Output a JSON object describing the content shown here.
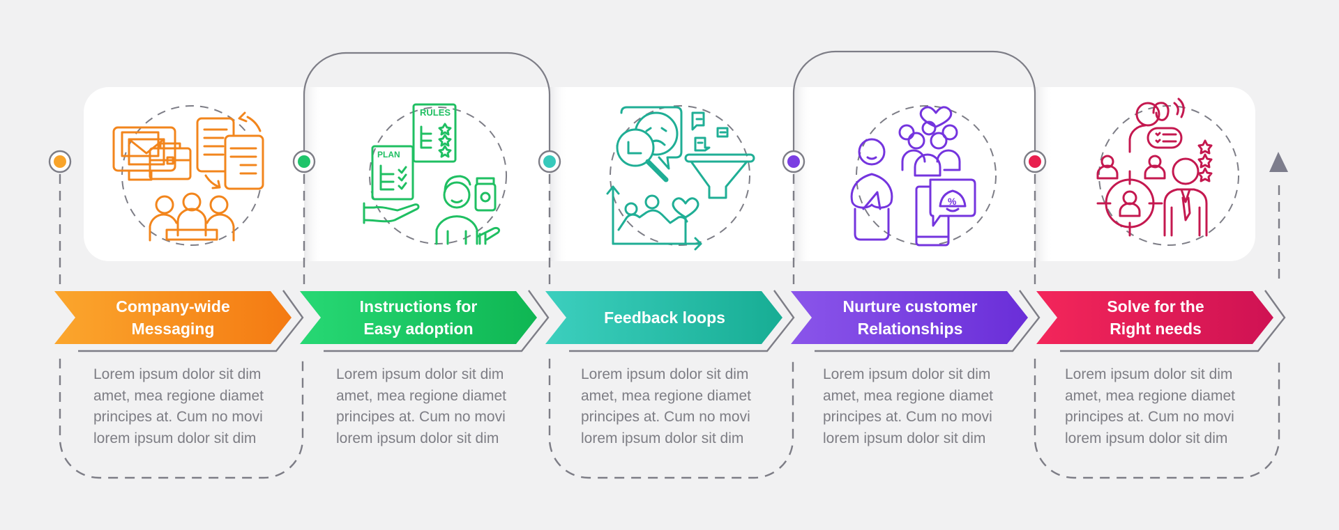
{
  "diagram": {
    "type": "process-infographic",
    "step_count": 5,
    "flow_direction": "left-to-right",
    "colors": {
      "background": "#f1f1f2",
      "card": "#ffffff",
      "connector": "#7d7d86",
      "text_gray": "#7d7d84"
    },
    "steps": [
      {
        "title": "Company-wide\nMessaging",
        "description": "Lorem ipsum dolor sit dim\namet, mea regione diamet\nprincipes at. Cum no movi\nlorem ipsum dolor sit dim",
        "icon": "company-messaging-icon",
        "color_start": "#fba62d",
        "color_end": "#f47a12",
        "marker_color": "#f9a42a"
      },
      {
        "title": "Instructions for\nEasy adoption",
        "description": "Lorem ipsum dolor sit dim\namet, mea regione diamet\nprincipes at. Cum no movi\nlorem ipsum dolor sit dim",
        "icon": "plan-rules-adoption-icon",
        "color_start": "#27d874",
        "color_end": "#0fb653",
        "marker_color": "#1fc46a"
      },
      {
        "title": "Feedback loops",
        "description": "Lorem ipsum dolor sit dim\namet, mea regione diamet\nprincipes at. Cum no movi\nlorem ipsum dolor sit dim",
        "icon": "feedback-funnel-icon",
        "color_start": "#3ccfbe",
        "color_end": "#17ad94",
        "marker_color": "#37c9bb"
      },
      {
        "title": "Nurture customer\nRelationships",
        "description": "Lorem ipsum dolor sit dim\namet, mea regione diamet\nprincipes at. Cum no movi\nlorem ipsum dolor sit dim",
        "icon": "customer-relationship-icon",
        "color_start": "#8a55ea",
        "color_end": "#6a2ed8",
        "marker_color": "#7a3ee2"
      },
      {
        "title": "Solve for the\nRight needs",
        "description": "Lorem ipsum dolor sit dim\namet, mea regione diamet\nprincipes at. Cum no movi\nlorem ipsum dolor sit dim",
        "icon": "target-needs-icon",
        "color_start": "#f3265a",
        "color_end": "#cf1253",
        "marker_color": "#e81f4e"
      }
    ],
    "icon_labels": {
      "plan": "PLAN",
      "rules": "RULES",
      "percent": "%"
    }
  }
}
